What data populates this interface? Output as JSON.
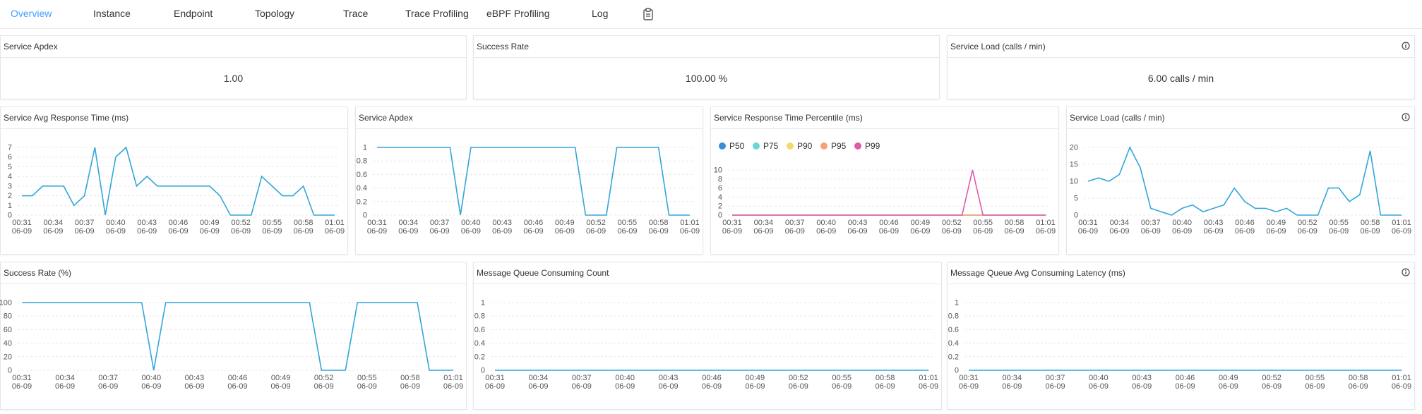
{
  "tabs": [
    "Overview",
    "Instance",
    "Endpoint",
    "Topology",
    "Trace",
    "Trace Profiling",
    "eBPF Profiling",
    "Log"
  ],
  "active_tab": "Overview",
  "icons": {
    "tab_extra": "clipboard-icon",
    "panel_info": "info-icon"
  },
  "colors": {
    "accent": "#409eff",
    "line": "#32a6d8",
    "p50": "#3a8fd9",
    "p75": "#6ad6d6",
    "p90": "#f5d96b",
    "p95": "#f7a07e",
    "p99": "#e05aa7"
  },
  "cards": {
    "apdex": {
      "title": "Service Apdex",
      "value": "1.00"
    },
    "success": {
      "title": "Success Rate",
      "value": "100.00",
      "unit": "%"
    },
    "load": {
      "title": "Service Load (calls / min)",
      "value": "6.00",
      "unit": "calls / min"
    }
  },
  "time_labels": [
    "00:31",
    "00:34",
    "00:37",
    "00:40",
    "00:43",
    "00:46",
    "00:49",
    "00:52",
    "00:55",
    "00:58",
    "01:01"
  ],
  "date_label": "06-09",
  "chart_data": [
    {
      "id": "avg_rt",
      "type": "line",
      "title": "Service Avg Response Time (ms)",
      "ylim": [
        0,
        7
      ],
      "yticks": [
        0,
        1,
        2,
        3,
        4,
        5,
        6,
        7
      ],
      "series": [
        {
          "values": [
            2,
            2,
            3,
            3,
            3,
            1,
            2,
            7,
            0,
            6,
            7,
            3,
            4,
            3,
            3,
            3,
            3,
            3,
            3,
            2,
            0,
            0,
            0,
            4,
            3,
            2,
            2,
            3,
            0,
            0,
            0
          ]
        }
      ]
    },
    {
      "id": "apdex_line",
      "type": "line",
      "title": "Service Apdex",
      "ylim": [
        0,
        1
      ],
      "yticks": [
        0,
        0.2,
        0.4,
        0.6,
        0.8,
        1
      ],
      "series": [
        {
          "values": [
            1,
            1,
            1,
            1,
            1,
            1,
            1,
            1,
            0,
            1,
            1,
            1,
            1,
            1,
            1,
            1,
            1,
            1,
            1,
            1,
            0,
            0,
            0,
            1,
            1,
            1,
            1,
            1,
            0,
            0,
            0
          ]
        }
      ]
    },
    {
      "id": "percentile",
      "type": "line",
      "title": "Service Response Time Percentile (ms)",
      "ylim": [
        0,
        10
      ],
      "yticks": [
        0,
        2,
        4,
        6,
        8,
        10
      ],
      "series": [
        {
          "name": "P50",
          "values": [
            0,
            0,
            0,
            0,
            0,
            0,
            0,
            0,
            0,
            0,
            0,
            0,
            0,
            0,
            0,
            0,
            0,
            0,
            0,
            0,
            0,
            0,
            0,
            0,
            0,
            0,
            0,
            0,
            0,
            0,
            0
          ]
        },
        {
          "name": "P75",
          "values": [
            0,
            0,
            0,
            0,
            0,
            0,
            0,
            0,
            0,
            0,
            0,
            0,
            0,
            0,
            0,
            0,
            0,
            0,
            0,
            0,
            0,
            0,
            0,
            0,
            0,
            0,
            0,
            0,
            0,
            0,
            0
          ]
        },
        {
          "name": "P90",
          "values": [
            0,
            0,
            0,
            0,
            0,
            0,
            0,
            0,
            0,
            0,
            0,
            0,
            0,
            0,
            0,
            0,
            0,
            0,
            0,
            0,
            0,
            0,
            0,
            0,
            0,
            0,
            0,
            0,
            0,
            0,
            0
          ]
        },
        {
          "name": "P95",
          "values": [
            0,
            0,
            0,
            0,
            0,
            0,
            0,
            0,
            0,
            0,
            0,
            0,
            0,
            0,
            0,
            0,
            0,
            0,
            0,
            0,
            0,
            0,
            0,
            0,
            0,
            0,
            0,
            0,
            0,
            0,
            0
          ]
        },
        {
          "name": "P99",
          "values": [
            0,
            0,
            0,
            0,
            0,
            0,
            0,
            0,
            0,
            0,
            0,
            0,
            0,
            0,
            0,
            0,
            0,
            0,
            0,
            0,
            0,
            0,
            0,
            10,
            0,
            0,
            0,
            0,
            0,
            0,
            0
          ]
        }
      ]
    },
    {
      "id": "load_line",
      "type": "line",
      "title": "Service Load (calls / min)",
      "ylim": [
        0,
        20
      ],
      "yticks": [
        0,
        5,
        10,
        15,
        20
      ],
      "series": [
        {
          "values": [
            10,
            11,
            10,
            12,
            20,
            14,
            2,
            1,
            0,
            2,
            3,
            1,
            2,
            3,
            8,
            4,
            2,
            2,
            1,
            2,
            0,
            0,
            0,
            8,
            8,
            4,
            6,
            19,
            0,
            0,
            0
          ]
        }
      ]
    },
    {
      "id": "success_line",
      "type": "line",
      "title": "Success Rate (%)",
      "ylim": [
        0,
        100
      ],
      "yticks": [
        0,
        20,
        40,
        60,
        80,
        100
      ],
      "series": [
        {
          "values": [
            100,
            100,
            100,
            100,
            100,
            100,
            100,
            100,
            100,
            100,
            100,
            0,
            100,
            100,
            100,
            100,
            100,
            100,
            100,
            100,
            100,
            100,
            100,
            100,
            100,
            0,
            0,
            0,
            100,
            100,
            100,
            100,
            100,
            100,
            0,
            0,
            0
          ]
        }
      ]
    },
    {
      "id": "mq_count",
      "type": "line",
      "title": "Message Queue Consuming Count",
      "ylim": [
        0,
        1
      ],
      "yticks": [
        0,
        0.2,
        0.4,
        0.6,
        0.8,
        1
      ],
      "series": [
        {
          "values": [
            0,
            0,
            0,
            0,
            0,
            0,
            0,
            0,
            0,
            0,
            0
          ]
        }
      ]
    },
    {
      "id": "mq_latency",
      "type": "line",
      "title": "Message Queue Avg Consuming Latency (ms)",
      "ylim": [
        0,
        1
      ],
      "yticks": [
        0,
        0.2,
        0.4,
        0.6,
        0.8,
        1
      ],
      "series": [
        {
          "values": [
            0,
            0,
            0,
            0,
            0,
            0,
            0,
            0,
            0,
            0,
            0
          ]
        }
      ]
    }
  ]
}
